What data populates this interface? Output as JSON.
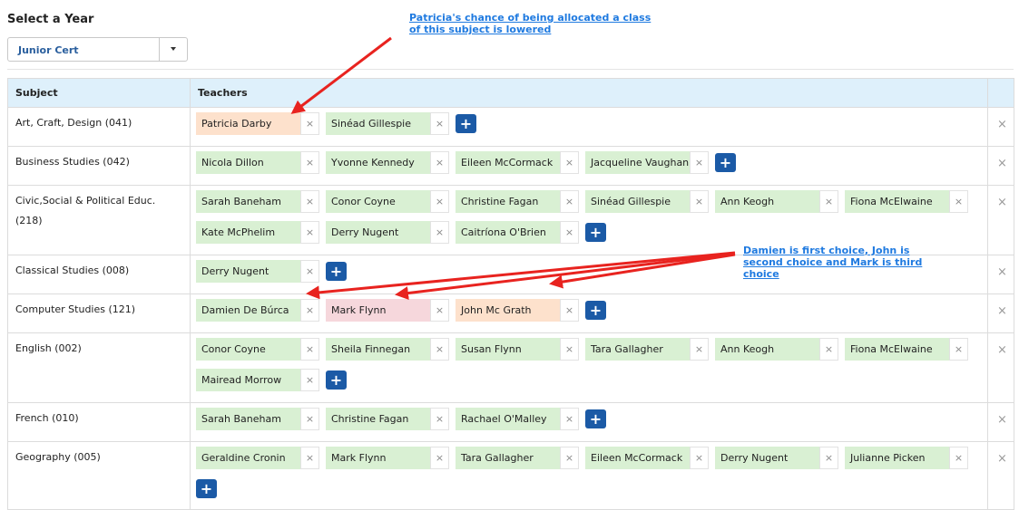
{
  "year_label": "Select a Year",
  "year_select": {
    "value": "Junior Cert",
    "icon": "caret-down-icon"
  },
  "table": {
    "headers": {
      "subject": "Subject",
      "teachers": "Teachers"
    },
    "remove_glyph": "×",
    "add_glyph": "+",
    "rows": [
      {
        "subject": "Art, Craft, Design (041)",
        "teachers": [
          {
            "name": "Patricia Darby",
            "highlight": "orange"
          },
          {
            "name": "Sinéad Gillespie",
            "highlight": "none"
          }
        ]
      },
      {
        "subject": "Business Studies (042)",
        "teachers": [
          {
            "name": "Nicola Dillon",
            "highlight": "none"
          },
          {
            "name": "Yvonne Kennedy",
            "highlight": "none"
          },
          {
            "name": "Eileen McCormack",
            "highlight": "none"
          },
          {
            "name": "Jacqueline Vaughan",
            "highlight": "none"
          }
        ]
      },
      {
        "subject": "Civic,Social & Political Educ. (218)",
        "teachers": [
          {
            "name": "Sarah Baneham",
            "highlight": "none"
          },
          {
            "name": "Conor Coyne",
            "highlight": "none"
          },
          {
            "name": "Christine Fagan",
            "highlight": "none"
          },
          {
            "name": "Sinéad Gillespie",
            "highlight": "none"
          },
          {
            "name": "Ann Keogh",
            "highlight": "none"
          },
          {
            "name": "Fiona McElwaine",
            "highlight": "none"
          },
          {
            "name": "Kate McPhelim",
            "highlight": "none"
          },
          {
            "name": "Derry Nugent",
            "highlight": "none"
          },
          {
            "name": "Caitríona O'Brien",
            "highlight": "none"
          }
        ]
      },
      {
        "subject": "Classical Studies (008)",
        "teachers": [
          {
            "name": "Derry Nugent",
            "highlight": "none"
          }
        ]
      },
      {
        "subject": "Computer Studies (121)",
        "teachers": [
          {
            "name": "Damien De Búrca",
            "highlight": "none"
          },
          {
            "name": "Mark Flynn",
            "highlight": "pink"
          },
          {
            "name": "John Mc Grath",
            "highlight": "orange"
          }
        ]
      },
      {
        "subject": "English (002)",
        "teachers": [
          {
            "name": "Conor Coyne",
            "highlight": "none"
          },
          {
            "name": "Sheila Finnegan",
            "highlight": "none"
          },
          {
            "name": "Susan Flynn",
            "highlight": "none"
          },
          {
            "name": "Tara Gallagher",
            "highlight": "none"
          },
          {
            "name": "Ann Keogh",
            "highlight": "none"
          },
          {
            "name": "Fiona McElwaine",
            "highlight": "none"
          },
          {
            "name": "Mairead Morrow",
            "highlight": "none"
          }
        ]
      },
      {
        "subject": "French (010)",
        "teachers": [
          {
            "name": "Sarah Baneham",
            "highlight": "none"
          },
          {
            "name": "Christine Fagan",
            "highlight": "none"
          },
          {
            "name": "Rachael O'Malley",
            "highlight": "none"
          }
        ]
      },
      {
        "subject": "Geography (005)",
        "teachers": [
          {
            "name": "Geraldine Cronin",
            "highlight": "none"
          },
          {
            "name": "Mark Flynn",
            "highlight": "none"
          },
          {
            "name": "Tara Gallagher",
            "highlight": "none"
          },
          {
            "name": "Eileen McCormack",
            "highlight": "none"
          },
          {
            "name": "Derry Nugent",
            "highlight": "none"
          },
          {
            "name": "Julianne Picken",
            "highlight": "none"
          }
        ]
      }
    ]
  },
  "annotations": {
    "patricia": "Patricia's chance of being allocated a class of this subject is lowered",
    "damien": "Damien is first choice, John is second choice and Mark is third choice"
  },
  "colors": {
    "tag_default": "#d9f0d3",
    "tag_orange": "#fde1cc",
    "tag_pink": "#f6d7dc",
    "header_bg": "#def0fb",
    "add_button": "#1b5aa6",
    "annotation_text": "#1f7ae0",
    "arrow": "#e8231f"
  }
}
